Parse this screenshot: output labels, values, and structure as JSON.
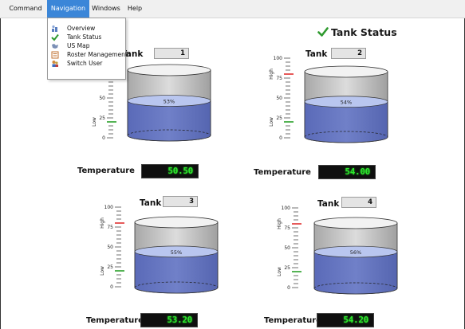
{
  "menubar": {
    "items": [
      {
        "label": "Command"
      },
      {
        "label": "Navigation"
      },
      {
        "label": "Windows"
      },
      {
        "label": "Help"
      }
    ]
  },
  "navigation_menu": {
    "items": [
      {
        "label": "Overview",
        "icon": "overview-icon"
      },
      {
        "label": "Tank Status",
        "icon": "checkmark-icon"
      },
      {
        "label": "US Map",
        "icon": "map-icon"
      },
      {
        "label": "Roster Management",
        "icon": "roster-icon"
      },
      {
        "label": "Switch User",
        "icon": "switch-user-icon"
      }
    ]
  },
  "header": {
    "title": "Tank Status",
    "icon": "checkmark-icon"
  },
  "colors": {
    "liquid": "#7080c8",
    "liquid_top": "#b9c6ef",
    "tank_gray": "#d2d2d2",
    "high_marker": "#e03030",
    "low_marker": "#2aa02a",
    "lcd_text": "#2ee82e",
    "menu_highlight": "#3b86d8"
  },
  "scale": {
    "ticks": [
      "100",
      "75",
      "50",
      "25",
      "0"
    ],
    "high_label": "High",
    "low_label": "Low"
  },
  "tanks": [
    {
      "label": "Tank",
      "number": "1",
      "level_percent": 53,
      "level_text": "53%",
      "temperature_label": "Temperature",
      "temperature": "50.50",
      "high_mark": 80,
      "low_mark": 20
    },
    {
      "label": "Tank",
      "number": "2",
      "level_percent": 54,
      "level_text": "54%",
      "temperature_label": "Temperature",
      "temperature": "54.00",
      "high_mark": 80,
      "low_mark": 20
    },
    {
      "label": "Tank",
      "number": "3",
      "level_percent": 55,
      "level_text": "55%",
      "temperature_label": "Temperature",
      "temperature": "53.20",
      "high_mark": 80,
      "low_mark": 20
    },
    {
      "label": "Tank",
      "number": "4",
      "level_percent": 56,
      "level_text": "56%",
      "temperature_label": "Temperature",
      "temperature": "54.20",
      "high_mark": 80,
      "low_mark": 20
    }
  ]
}
